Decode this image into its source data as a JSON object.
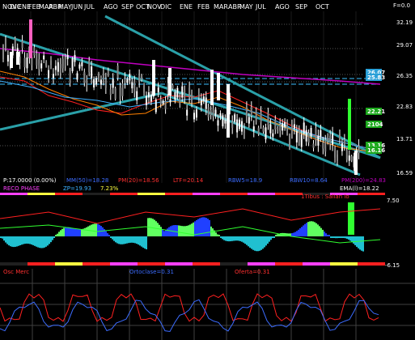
{
  "months": [
    "NOV",
    "DIC",
    "ENE",
    "FEB",
    "MAR",
    "ABR",
    "MAY",
    "JUN",
    "JUL",
    "AGO",
    "SEP",
    "OCT",
    "NOV",
    "DIC",
    "ENE",
    "FEB",
    "MAR",
    "ABR",
    "MAY",
    "JUL",
    "AGO",
    "SEP",
    "OCT"
  ],
  "right_axis": {
    "f_label": "F=0.0",
    "levels": [
      "32.19",
      "29.07",
      "26.35",
      "22.83",
      "13.71",
      "16.59"
    ],
    "badges": [
      {
        "text": "26.07",
        "color": "#2aa0d8"
      },
      {
        "text": "25.83",
        "color": "#2aa0d8"
      },
      {
        "text": "22.21",
        "color": "#1ca81c"
      },
      {
        "text": "2104",
        "color": "#1ca81c"
      },
      {
        "text": "13.16",
        "color": "#1ca81c"
      },
      {
        "text": "16.16",
        "color": "#1ca81c"
      }
    ]
  },
  "indicators": {
    "row1": [
      {
        "text": "P:17.0000 (0.00%)",
        "color": "#ffffff"
      },
      {
        "text": "MM(50)=18.28",
        "color": "#3c6cff"
      },
      {
        "text": "PM(20)=18.56",
        "color": "#ff3030"
      },
      {
        "text": "LTF=20.14",
        "color": "#ff3030"
      },
      {
        "text": "RBW5=18.9",
        "color": "#3c6cff"
      },
      {
        "text": "RBW10=8.64",
        "color": "#3c6cff"
      },
      {
        "text": "PM(200)=24.83",
        "color": "#c000c0"
      }
    ],
    "row2": [
      {
        "text": "RECO PHASE",
        "color": "#ff40ff"
      },
      {
        "text": "ZP=19.93",
        "color": "#3cb0ff"
      },
      {
        "text": "7.23%",
        "color": "#ffff40"
      },
      {
        "text": "EMA(l)=18.22",
        "color": "#ffffff"
      }
    ]
  },
  "oscillator": {
    "title": "1Tibus : Salian lo",
    "upper": "7.50",
    "lower": "-6.15"
  },
  "bottom_panel": {
    "labels": [
      {
        "text": "Osc Merc",
        "color": "#ff3030"
      },
      {
        "text": "Ortoclase=0.31",
        "color": "#3c6cff"
      },
      {
        "text": "Oferta=0.31",
        "color": "#ff3030"
      }
    ]
  },
  "colors": {
    "background": "#000000",
    "candle": "#ffffff",
    "trendline": "#2aa0a8",
    "ma50": "#c000c0",
    "ma20": "#ff2020",
    "ltf": "#ff8000",
    "zp": "#3cb0ff"
  }
}
